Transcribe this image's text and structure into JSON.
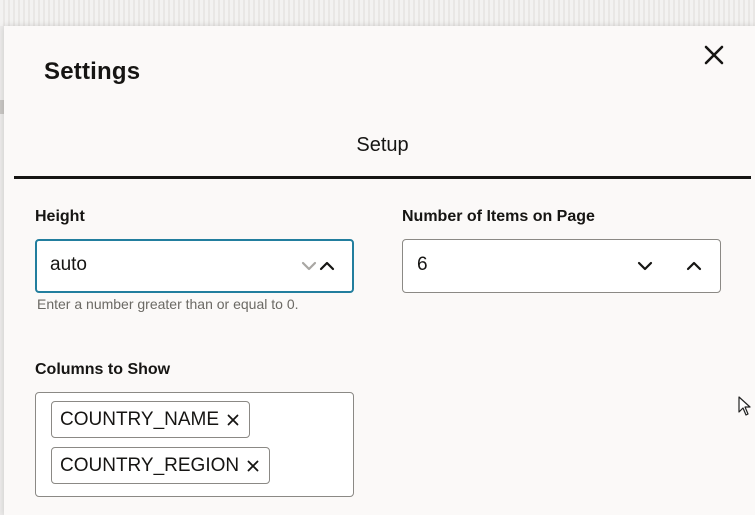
{
  "dialog": {
    "title": "Settings",
    "close_icon": "close-icon"
  },
  "tabs": [
    {
      "label": "Setup",
      "selected": true
    }
  ],
  "height_field": {
    "label": "Height",
    "value": "auto",
    "help_text": "Enter a number greater than or equal to 0.",
    "decrement_icon": "chevron-down-icon",
    "increment_icon": "chevron-up-icon",
    "focused": true
  },
  "items_field": {
    "label": "Number of Items on Page",
    "value": "6",
    "decrement_icon": "chevron-down-icon",
    "increment_icon": "chevron-up-icon"
  },
  "columns_field": {
    "label": "Columns to Show",
    "chips": [
      {
        "label": "COUNTRY_NAME",
        "remove_icon": "remove-icon"
      },
      {
        "label": "COUNTRY_REGION",
        "remove_icon": "remove-icon"
      }
    ]
  },
  "colors": {
    "focus_border": "#227e9e",
    "text": "#161513",
    "help_text": "#6b6964",
    "dialog_bg": "#fbf9f8"
  }
}
